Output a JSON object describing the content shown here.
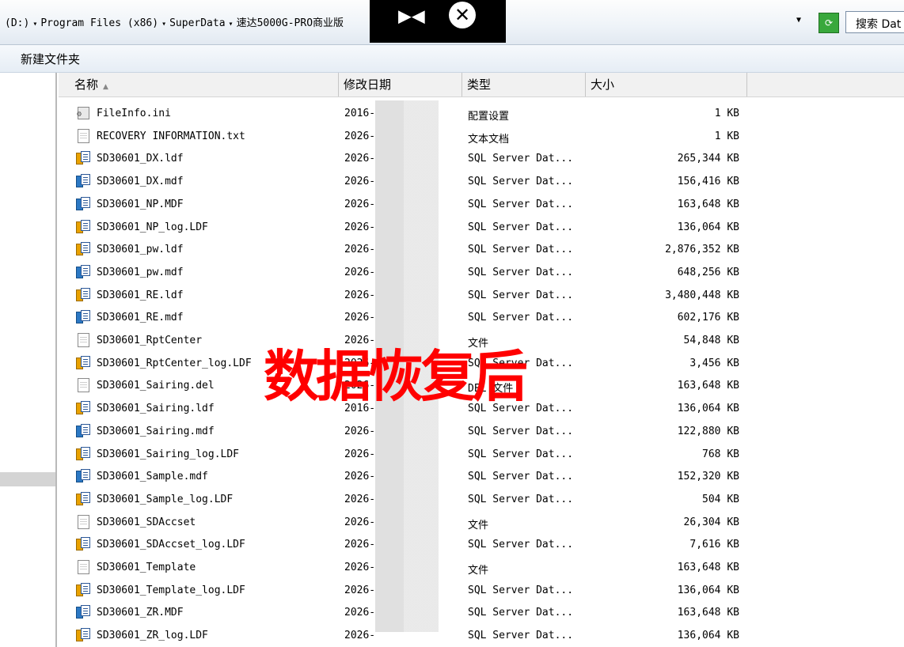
{
  "address": {
    "segments": [
      "(D:)",
      "Program Files (x86)",
      "SuperData",
      "速达5000G-PRO商业版"
    ],
    "search_placeholder": "搜索 Dat"
  },
  "toolbar": {
    "new_folder_label": "新建文件夹"
  },
  "overlay": {
    "play_icon": "skip-icon",
    "close_icon": "close-circle-icon"
  },
  "columns": {
    "name": "名称",
    "modified": "修改日期",
    "type": "类型",
    "size": "大小"
  },
  "watermark": "数据恢复后",
  "files": [
    {
      "icon": "config-file-icon",
      "name": "FileInfo.ini",
      "date": "2016-",
      "type": "配置设置",
      "size": "1 KB"
    },
    {
      "icon": "text-file-icon",
      "name": "RECOVERY INFORMATION.txt",
      "date": "2026-",
      "type": "文本文档",
      "size": "1 KB"
    },
    {
      "icon": "sql-log-icon",
      "name": "SD30601_DX.ldf",
      "date": "2026-",
      "type": "SQL Server Dat...",
      "size": "265,344 KB"
    },
    {
      "icon": "sql-data-icon",
      "name": "SD30601_DX.mdf",
      "date": "2026-",
      "type": "SQL Server Dat...",
      "size": "156,416 KB"
    },
    {
      "icon": "sql-data-icon",
      "name": "SD30601_NP.MDF",
      "date": "2026-",
      "type": "SQL Server Dat...",
      "size": "163,648 KB"
    },
    {
      "icon": "sql-log-icon",
      "name": "SD30601_NP_log.LDF",
      "date": "2026-",
      "type": "SQL Server Dat...",
      "size": "136,064 KB"
    },
    {
      "icon": "sql-log-icon",
      "name": "SD30601_pw.ldf",
      "date": "2026-",
      "type": "SQL Server Dat...",
      "size": "2,876,352 KB"
    },
    {
      "icon": "sql-data-icon",
      "name": "SD30601_pw.mdf",
      "date": "2026-",
      "type": "SQL Server Dat...",
      "size": "648,256 KB"
    },
    {
      "icon": "sql-log-icon",
      "name": "SD30601_RE.ldf",
      "date": "2026-",
      "type": "SQL Server Dat...",
      "size": "3,480,448 KB"
    },
    {
      "icon": "sql-data-icon",
      "name": "SD30601_RE.mdf",
      "date": "2026-",
      "type": "SQL Server Dat...",
      "size": "602,176 KB"
    },
    {
      "icon": "blank-file-icon",
      "name": "SD30601_RptCenter",
      "date": "2026-",
      "type": "文件",
      "size": "54,848 KB"
    },
    {
      "icon": "sql-log-icon",
      "name": "SD30601_RptCenter_log.LDF",
      "date": "2026-",
      "type": "SQL Server Dat...",
      "size": "3,456 KB"
    },
    {
      "icon": "blank-file-icon",
      "name": "SD30601_Sairing.del",
      "date": "2026-",
      "type": "DEL 文件",
      "size": "163,648 KB"
    },
    {
      "icon": "sql-log-icon",
      "name": "SD30601_Sairing.ldf",
      "date": "2016-",
      "type": "SQL Server Dat...",
      "size": "136,064 KB"
    },
    {
      "icon": "sql-data-icon",
      "name": "SD30601_Sairing.mdf",
      "date": "2026-",
      "type": "SQL Server Dat...",
      "size": "122,880 KB"
    },
    {
      "icon": "sql-log-icon",
      "name": "SD30601_Sairing_log.LDF",
      "date": "2026-",
      "type": "SQL Server Dat...",
      "size": "768 KB"
    },
    {
      "icon": "sql-data-icon",
      "name": "SD30601_Sample.mdf",
      "date": "2026-",
      "type": "SQL Server Dat...",
      "size": "152,320 KB"
    },
    {
      "icon": "sql-log-icon",
      "name": "SD30601_Sample_log.LDF",
      "date": "2026-",
      "type": "SQL Server Dat...",
      "size": "504 KB"
    },
    {
      "icon": "blank-file-icon",
      "name": "SD30601_SDAccset",
      "date": "2026-",
      "type": "文件",
      "size": "26,304 KB"
    },
    {
      "icon": "sql-log-icon",
      "name": "SD30601_SDAccset_log.LDF",
      "date": "2026-",
      "type": "SQL Server Dat...",
      "size": "7,616 KB"
    },
    {
      "icon": "blank-file-icon",
      "name": "SD30601_Template",
      "date": "2026-",
      "type": "文件",
      "size": "163,648 KB"
    },
    {
      "icon": "sql-log-icon",
      "name": "SD30601_Template_log.LDF",
      "date": "2026-",
      "type": "SQL Server Dat...",
      "size": "136,064 KB"
    },
    {
      "icon": "sql-data-icon",
      "name": "SD30601_ZR.MDF",
      "date": "2026-",
      "type": "SQL Server Dat...",
      "size": "163,648 KB"
    },
    {
      "icon": "sql-log-icon",
      "name": "SD30601_ZR_log.LDF",
      "date": "2026-",
      "type": "SQL Server Dat...",
      "size": "136,064 KB"
    }
  ]
}
